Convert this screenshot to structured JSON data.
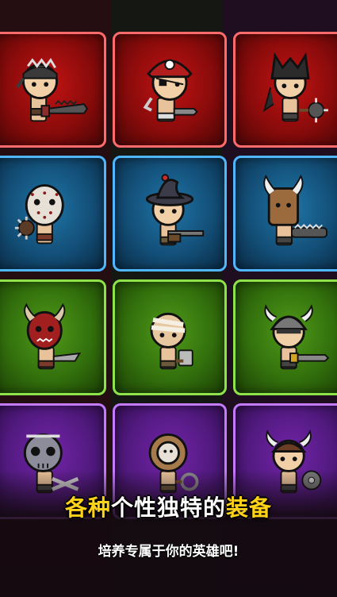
{
  "headline": {
    "part1": "各种",
    "part2": "个性独特的",
    "part3": "装备",
    "highlight_color": "#ffd21a"
  },
  "subtitle": "培养专属于你的英雄吧!",
  "heroes": [
    {
      "row": 0,
      "theme": "red",
      "description": "bandana hero with serrated sword"
    },
    {
      "row": 0,
      "theme": "red",
      "description": "pirate hero with skull hat and hook"
    },
    {
      "row": 0,
      "theme": "red",
      "description": "wolf-hood hero with spiked mace"
    },
    {
      "row": 1,
      "theme": "blue",
      "description": "hockey-mask hero with spiked club"
    },
    {
      "row": 1,
      "theme": "blue",
      "description": "witch-hat hero with rifle"
    },
    {
      "row": 1,
      "theme": "blue",
      "description": "horned bag-head hero with chainsaw"
    },
    {
      "row": 2,
      "theme": "green",
      "description": "red demon-mask hero with knife"
    },
    {
      "row": 2,
      "theme": "green",
      "description": "bandaged hero with meat cleaver"
    },
    {
      "row": 2,
      "theme": "green",
      "description": "viking helmet hero with sword"
    },
    {
      "row": 3,
      "theme": "purple",
      "description": "skull-mask hero with crossbones"
    },
    {
      "row": 3,
      "theme": "purple",
      "description": "diving-helmet hero with wheel"
    },
    {
      "row": 3,
      "theme": "purple",
      "description": "horned helmet hero with shield"
    }
  ],
  "colors": {
    "red": "#c21313",
    "blue": "#1f75a8",
    "green": "#4f9a19",
    "purple": "#7324a8"
  }
}
